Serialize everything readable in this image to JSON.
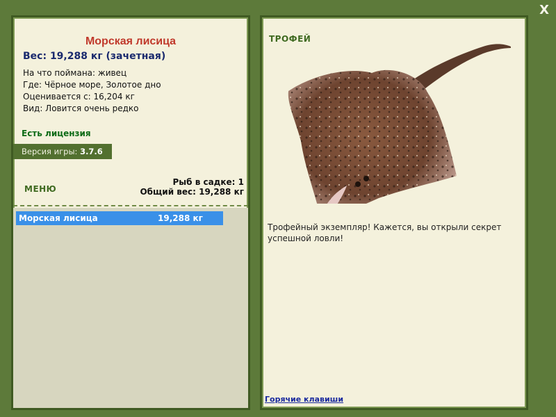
{
  "window": {
    "close_label": "X"
  },
  "fish": {
    "title": "Морская лисица",
    "weight_line": "Вес: 19,288 кг (зачетная)",
    "info": [
      "На что поймана: живец",
      "Где: Чёрное море, Золотое дно",
      "Оценивается с: 16,204 кг",
      "Вид: Ловится очень редко"
    ]
  },
  "license_label": "Есть лицензия",
  "version": {
    "label": "Версия игры:",
    "value": "3.7.6"
  },
  "menu_label": "МЕНЮ",
  "cage": {
    "fish_count_line": "Рыб в садке: 1",
    "total_weight_line": "Общий вес: 19,288 кг"
  },
  "catch_list": [
    {
      "name": "Морская лисица",
      "weight": "19,288 кг"
    }
  ],
  "trophy": {
    "label": "ТРОФЕЙ",
    "text": "Трофейный экземпляр! Кажется, вы открыли секрет успешной ловли!"
  },
  "hotkeys_link": "Горячие клавиши",
  "colors": {
    "background": "#5d7a3a",
    "panel": "#f4f1dc",
    "title_red": "#c0392b",
    "weight_blue": "#1a2a6e",
    "license_green": "#0d6b16",
    "selection_blue": "#3a90e8"
  }
}
